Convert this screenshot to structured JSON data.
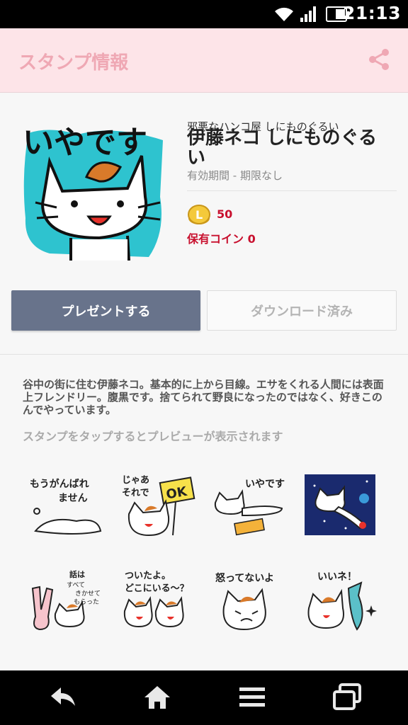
{
  "status_bar": {
    "time": "21:13"
  },
  "app_bar": {
    "title": "スタンプ情報"
  },
  "sticker_info": {
    "author": "邪悪なハンコ屋 しにものぐるい",
    "title": "伊藤ネコ しにものぐるい",
    "validity": "有効期間 - 期限なし",
    "price": "50",
    "owned_coins": "保有コイン 0",
    "main_thumb_text": "いやです"
  },
  "buttons": {
    "present": "プレゼントする",
    "downloaded": "ダウンロード済み"
  },
  "description": "谷中の街に住む伊藤ネコ。基本的に上から目線。エサをくれる人間には表面上フレンドリー。腹黒です。捨てられて野良になったのではなく、好きこのんでやっています。",
  "preview_hint": "スタンプをタップするとプレビューが表示されます",
  "stickers": [
    {
      "text": "もうがんばれ ません"
    },
    {
      "text": "じゃあ それで OK"
    },
    {
      "text": "いやです"
    },
    {
      "text": ""
    },
    {
      "text": "話は すべて きかせて もらった"
    },
    {
      "text": "ついたよ。 どこにいる〜？"
    },
    {
      "text": "怒ってないよ"
    },
    {
      "text": "いいネ！"
    }
  ],
  "colors": {
    "app_bar_bg": "#fde4e8",
    "title_pink": "#efa8b4",
    "button_primary": "#68738b",
    "price_red": "#c8102e"
  }
}
